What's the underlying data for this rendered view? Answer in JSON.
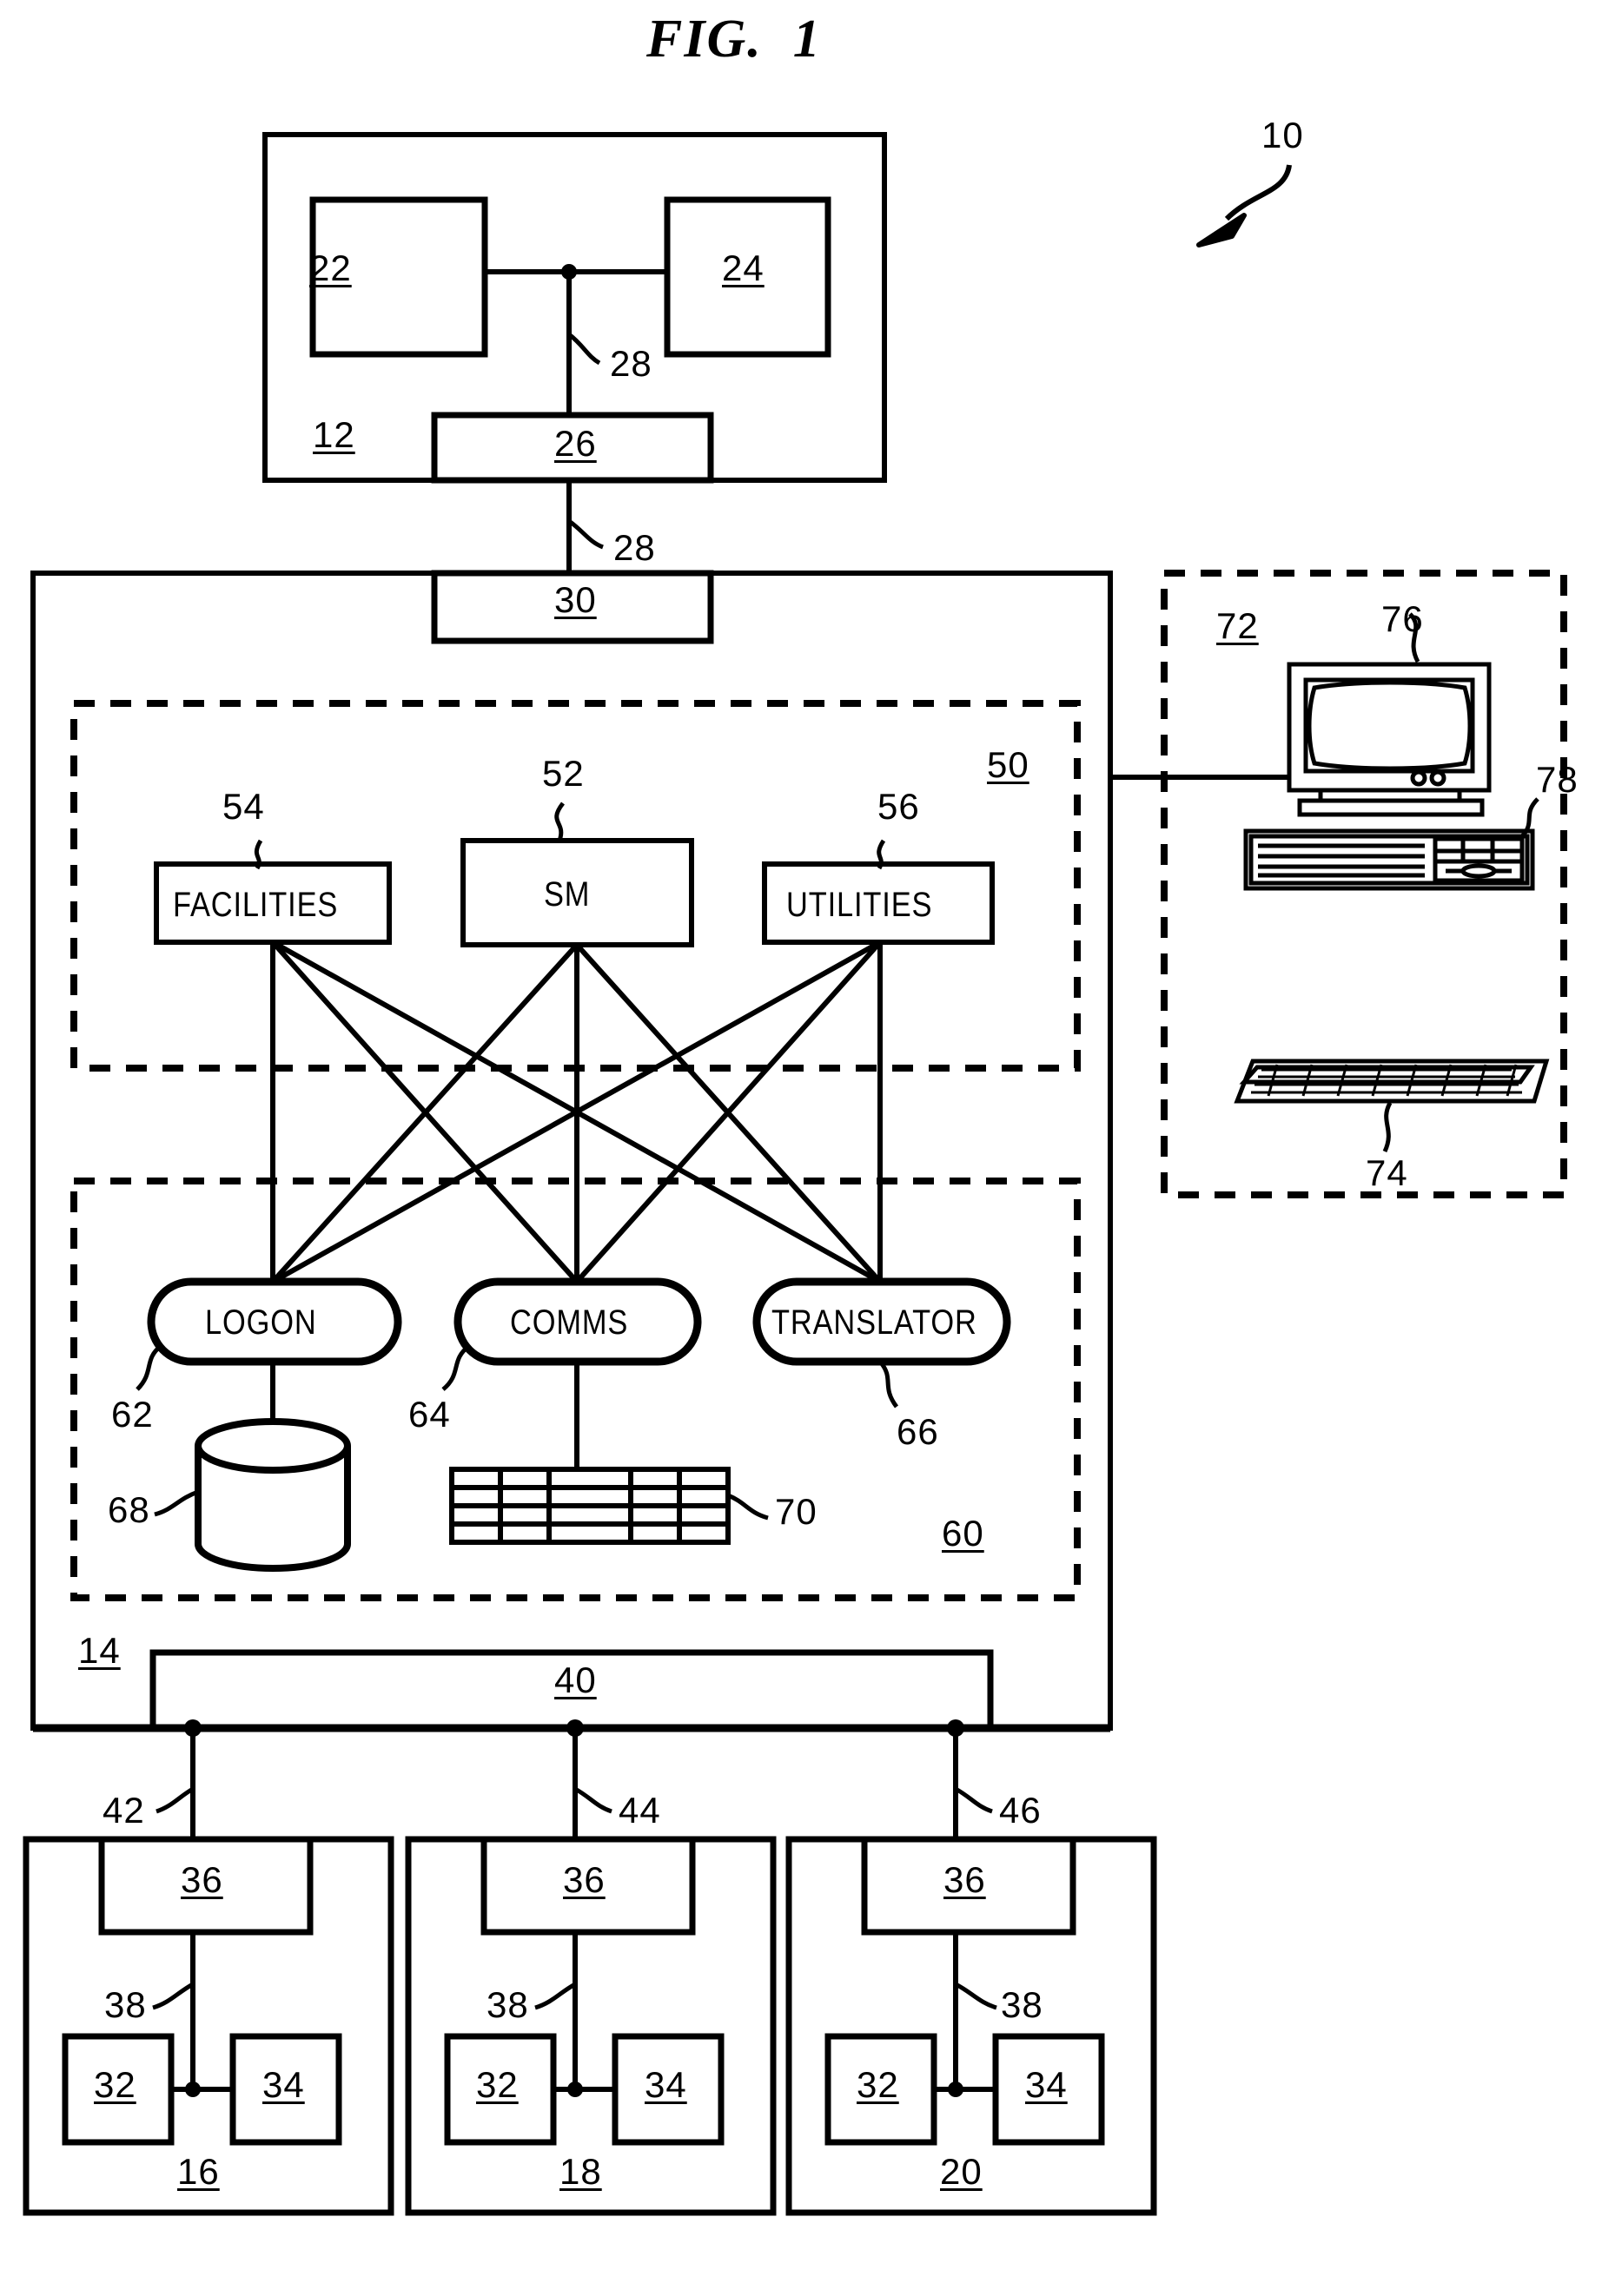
{
  "figure": {
    "title": "FIG.  1",
    "overall_ref": "10"
  },
  "blocks": {
    "host_system": {
      "ref": "12",
      "children": [
        {
          "ref": "22",
          "name": "host-box-22"
        },
        {
          "ref": "24",
          "name": "host-box-24"
        },
        {
          "ref": "26",
          "name": "host-interface-26"
        }
      ],
      "links": [
        {
          "ref": "28",
          "name": "internal-bus-28"
        },
        {
          "ref": "28",
          "name": "external-link-28"
        }
      ]
    },
    "server": {
      "ref": "14",
      "interface": {
        "ref": "30",
        "name": "server-interface-30"
      },
      "upper_group": {
        "ref": "50",
        "items": [
          {
            "ref": "54",
            "label": "FACILITIES",
            "name": "facilities-module"
          },
          {
            "ref": "52",
            "label": "SM",
            "name": "sm-module"
          },
          {
            "ref": "56",
            "label": "UTILITIES",
            "name": "utilities-module"
          }
        ]
      },
      "lower_group": {
        "ref": "60",
        "items": [
          {
            "ref": "62",
            "label": "LOGON",
            "name": "logon-process"
          },
          {
            "ref": "64",
            "label": "COMMS",
            "name": "comms-process"
          },
          {
            "ref": "66",
            "label": "TRANSLATOR",
            "name": "translator-process"
          }
        ],
        "stores": [
          {
            "ref": "68",
            "name": "logon-database",
            "shape": "cylinder"
          },
          {
            "ref": "70",
            "name": "comms-table",
            "shape": "table",
            "rows": 4,
            "cols": 5
          }
        ]
      },
      "bus": {
        "ref": "40",
        "name": "server-bus-40"
      },
      "bus_taps": [
        {
          "ref": "42",
          "name": "bus-tap-42"
        },
        {
          "ref": "44",
          "name": "bus-tap-44"
        },
        {
          "ref": "46",
          "name": "bus-tap-46"
        }
      ]
    },
    "workstation": {
      "ref": "72",
      "parts": [
        {
          "ref": "76",
          "name": "crt-monitor"
        },
        {
          "ref": "78",
          "name": "desktop-computer-case"
        },
        {
          "ref": "74",
          "name": "keyboard"
        }
      ]
    },
    "nodes": [
      {
        "ref": "16",
        "name": "node-16",
        "controller": {
          "ref": "36"
        },
        "link": {
          "ref": "38"
        },
        "devices": [
          {
            "ref": "32"
          },
          {
            "ref": "34"
          }
        ]
      },
      {
        "ref": "18",
        "name": "node-18",
        "controller": {
          "ref": "36"
        },
        "link": {
          "ref": "38"
        },
        "devices": [
          {
            "ref": "32"
          },
          {
            "ref": "34"
          }
        ]
      },
      {
        "ref": "20",
        "name": "node-20",
        "controller": {
          "ref": "36"
        },
        "link": {
          "ref": "38"
        },
        "devices": [
          {
            "ref": "32"
          },
          {
            "ref": "34"
          }
        ]
      }
    ]
  },
  "labels": {
    "t10": "10",
    "t12": "12",
    "t14": "14",
    "t16": "16",
    "t18": "18",
    "t20": "20",
    "t22": "22",
    "t24": "24",
    "t26": "26",
    "t28a": "28",
    "t28b": "28",
    "t30": "30",
    "t32a": "32",
    "t32b": "32",
    "t32c": "32",
    "t34a": "34",
    "t34b": "34",
    "t34c": "34",
    "t36a": "36",
    "t36b": "36",
    "t36c": "36",
    "t38a": "38",
    "t38b": "38",
    "t38c": "38",
    "t40": "40",
    "t42": "42",
    "t44": "44",
    "t46": "46",
    "t50": "50",
    "t52": "52",
    "t54": "54",
    "t56": "56",
    "t60": "60",
    "t62": "62",
    "t64": "64",
    "t66": "66",
    "t68": "68",
    "t70": "70",
    "t72": "72",
    "t74": "74",
    "t76": "76",
    "t78": "78",
    "facilities": "FACILITIES",
    "sm": "SM",
    "utilities": "UTILITIES",
    "logon": "LOGON",
    "comms": "COMMS",
    "translator": "TRANSLATOR"
  },
  "colors": {
    "ink": "#000000",
    "paper": "#ffffff"
  }
}
